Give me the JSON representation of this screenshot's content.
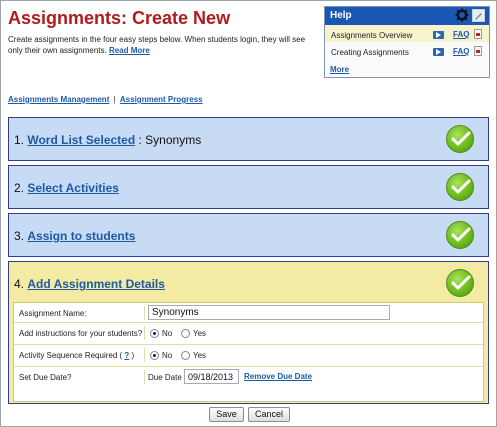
{
  "page": {
    "title": "Assignments: Create New",
    "intro_text": "Create assignments in the four easy steps below. When students login, they will see only their own assignments.",
    "read_more": "Read More"
  },
  "help": {
    "title": "Help",
    "items": [
      {
        "label": "Assignments Overview",
        "faq": "FAQ"
      },
      {
        "label": "Creating Assignments",
        "faq": "FAQ"
      }
    ],
    "more": "More"
  },
  "nav_links": {
    "management": "Assignments Management",
    "separator": "|",
    "progress": "Assignment Progress"
  },
  "steps": [
    {
      "number": "1.",
      "title": "Word List Selected",
      "suffix": " : Synonyms"
    },
    {
      "number": "2.",
      "title": "Select Activities",
      "suffix": ""
    },
    {
      "number": "3.",
      "title": "Assign to students",
      "suffix": ""
    },
    {
      "number": "4.",
      "title": "Add Assignment Details",
      "suffix": ""
    }
  ],
  "details": {
    "name_label": "Assignment Name:",
    "name_value": "Synonyms",
    "instructions_label": "Add instructions for your students?",
    "sequence_label": "Activity Sequence Required (",
    "sequence_help": "?",
    "sequence_close": " )",
    "no": "No",
    "yes": "Yes",
    "due_label": "Set Due Date?",
    "due_date_label": "Due Date",
    "due_date_value": "09/18/2013",
    "remove_due": "Remove Due Date"
  },
  "buttons": {
    "save": "Save",
    "cancel": "Cancel"
  },
  "colors": {
    "title_red": "#b11b1b",
    "link_blue": "#1d5aa6",
    "step_blue": "#c7dbf4",
    "step_yellow": "#f3eaa3",
    "check_green": "#6dbb1f"
  }
}
